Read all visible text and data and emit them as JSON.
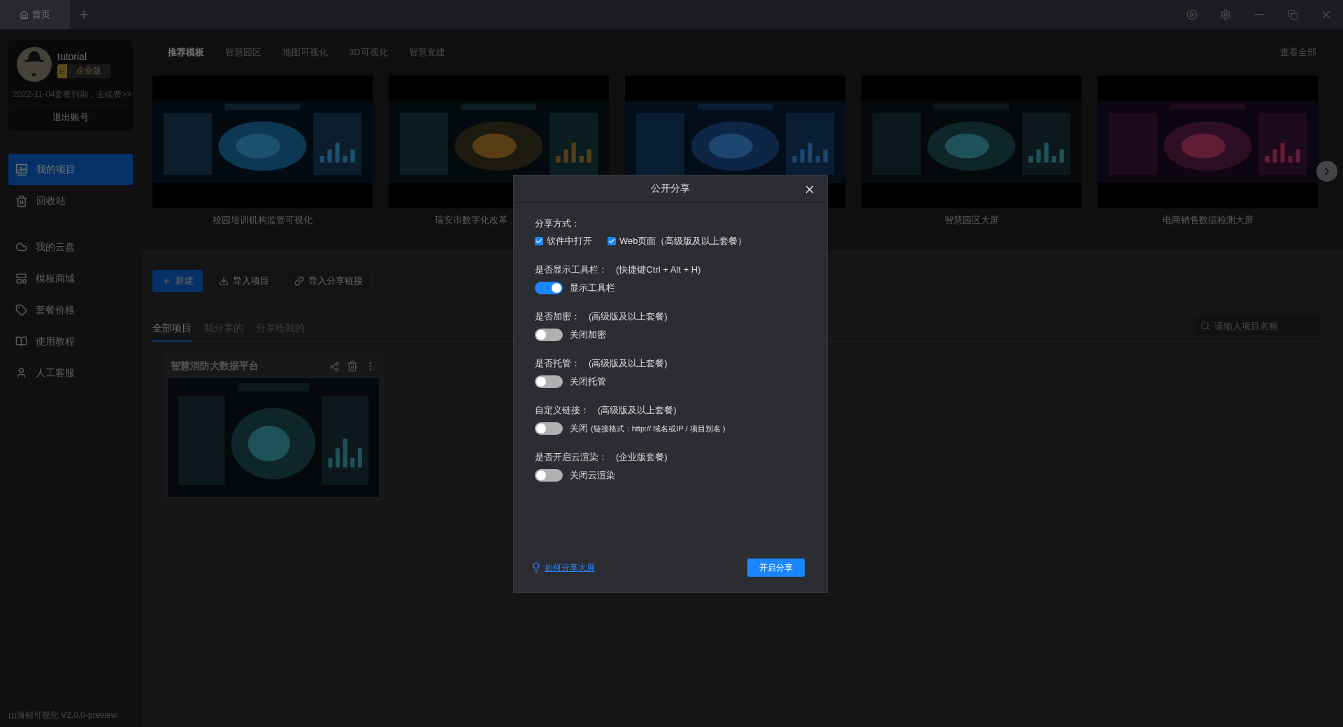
{
  "window": {
    "tabs": [
      {
        "label": "首页",
        "selected": true
      }
    ],
    "new_tab": "+"
  },
  "account": {
    "name": "tutorial",
    "badge_letter": "E",
    "badge": "企业版",
    "expiry": "2022-11-04套餐到期，去续费>>",
    "logout": "退出账号"
  },
  "sidebar": {
    "primary": [
      {
        "label": "我的项目",
        "selected": true
      },
      {
        "label": "回收站",
        "selected": false
      }
    ],
    "secondary": [
      {
        "label": "我的云盘",
        "selected": false
      },
      {
        "label": "模板商城",
        "selected": false
      },
      {
        "label": "套餐价格",
        "selected": false
      },
      {
        "label": "使用教程",
        "selected": false
      },
      {
        "label": "人工客服",
        "selected": false
      }
    ],
    "version": "山海鲸可视化 V2.0.0-preview"
  },
  "templates": {
    "categories": [
      {
        "label": "推荐模板",
        "selected": true
      },
      {
        "label": "智慧园区",
        "selected": false
      },
      {
        "label": "地图可视化",
        "selected": false
      },
      {
        "label": "3D可视化",
        "selected": false
      },
      {
        "label": "智慧党建",
        "selected": false
      }
    ],
    "view_all": "查看全部",
    "items": [
      {
        "kind": "captioned",
        "title": "校园培训机构监管可视化",
        "clipped": false
      },
      {
        "kind": "captioned",
        "title": "瑞安市数字化改革",
        "clipped": true
      },
      {
        "kind": "picture"
      },
      {
        "kind": "captioned",
        "title": "智慧园区大屏",
        "clipped": false
      },
      {
        "kind": "captioned",
        "title": "电商销售数据检测大屏",
        "clipped": false
      }
    ]
  },
  "projects": {
    "actions": [
      {
        "kind": "primary",
        "label": "新建"
      },
      {
        "kind": "import",
        "label": "导入项目"
      },
      {
        "kind": "link",
        "label": "导入分享链接"
      }
    ],
    "tabs": [
      {
        "label": "全部项目",
        "selected": true
      },
      {
        "label": "我分享的",
        "selected": false
      },
      {
        "label": "分享给我的",
        "selected": false
      }
    ],
    "search": {
      "placeholder": "请输入项目名称"
    },
    "items": [
      {
        "title": "智慧消防大数据平台"
      }
    ]
  },
  "dialog": {
    "title": "公开分享",
    "share_method": {
      "label": "分享方式：",
      "options": [
        {
          "label": "软件中打开",
          "checked": true
        },
        {
          "label": "Web页面（高级版及以上套餐）",
          "checked": true
        }
      ]
    },
    "settings": [
      {
        "label": "是否显示工具栏：",
        "note": "(快捷键Ctrl + Alt + H)",
        "on": true,
        "text": "显示工具栏"
      },
      {
        "label": "是否加密：",
        "note": "(高级版及以上套餐)",
        "on": false,
        "text": "关闭加密"
      },
      {
        "label": "是否托管：",
        "note": "(高级版及以上套餐)",
        "on": false,
        "text": "关闭托管"
      },
      {
        "label": "自定义链接：",
        "note": "(高级版及以上套餐)",
        "on": false,
        "text": "关闭",
        "hint": "(链接格式：http:// 域名或IP / 项目别名 )"
      },
      {
        "label": "是否开启云渲染：",
        "note": "(企业版套餐)",
        "on": false,
        "text": "关闭云渲染"
      }
    ],
    "help_link": "如何分享大屏",
    "confirm": "开启分享"
  }
}
